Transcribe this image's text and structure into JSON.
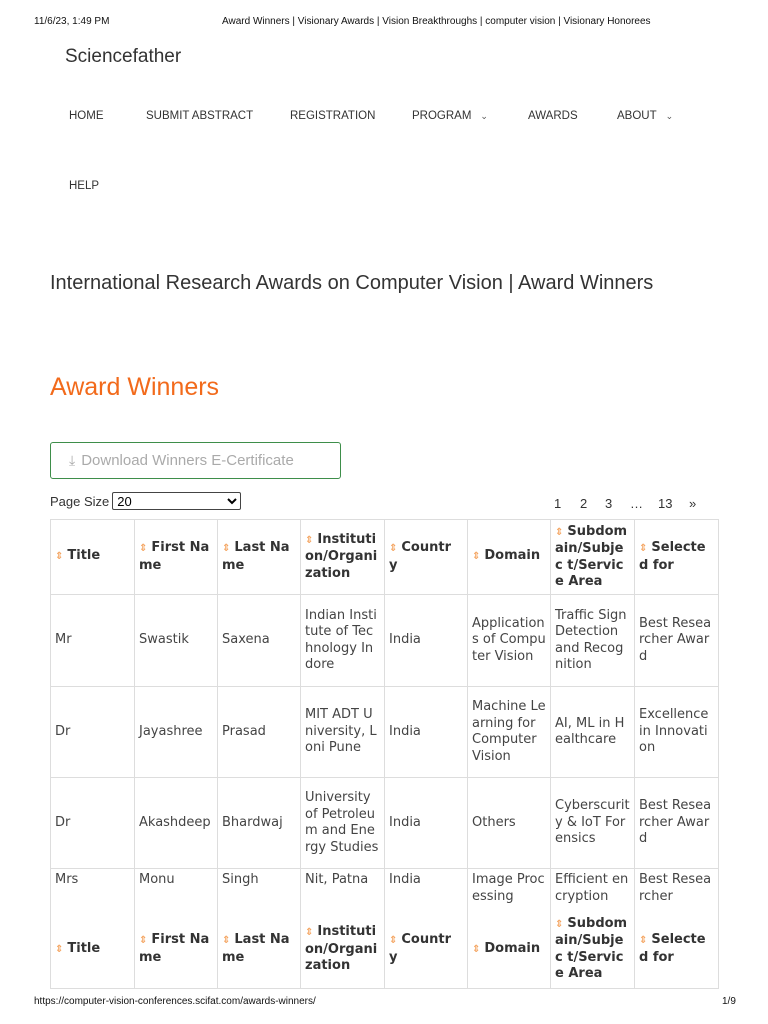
{
  "print_header": {
    "datetime": "11/6/23, 1:49 PM",
    "title": "Award Winners | Visionary Awards | Vision Breakthroughs | computer vision | Visionary Honorees"
  },
  "brand": "Sciencefather",
  "nav": [
    "HOME",
    "SUBMIT ABSTRACT",
    "REGISTRATION",
    "PROGRAM",
    "AWARDS",
    "ABOUT",
    "HELP"
  ],
  "heading": "International Research Awards on Computer Vision | Award Winners",
  "section_title": "Award Winners",
  "download_label": "Download Winners E-Certificate",
  "page_size": {
    "label": "Page Size",
    "value": "20"
  },
  "pagination": [
    "1",
    "2",
    "3",
    "…",
    "13",
    "»"
  ],
  "columns": [
    "Title",
    "First Name",
    "Last Name",
    "Instituti on/Organi zation",
    "Countr y",
    "Domain",
    "Subdom ain/Subjec t/Service Area",
    "Selected for"
  ],
  "rows": [
    [
      "Mr",
      "Swastik",
      "Saxena",
      "Indian Institute of Technology Indore",
      "India",
      "Applications of Computer Vision",
      "Traffic Sign Detection and Recognition",
      "Best Researcher Award"
    ],
    [
      "Dr",
      "Jayashree",
      "Prasad",
      "MIT ADT University, Loni Pune",
      "India",
      "Machine Learning for Computer Vision",
      "AI, ML in Healthcare",
      "Excellence in Innovation"
    ],
    [
      "Dr",
      "Akashdeep",
      "Bhardwaj",
      "University of Petroleum and Energy Studies",
      "India",
      "Others",
      "Cyberscurity & IoT Forensics",
      "Best Researcher Award"
    ],
    [
      "Mrs",
      "Monu",
      "Singh",
      "Nit, Patna",
      "India",
      "Image Processing",
      "Efficient encryption",
      "Best Researcher"
    ]
  ],
  "footer": {
    "url": "https://computer-vision-conferences.scifat.com/awards-winners/",
    "page": "1/9"
  },
  "colors": {
    "accent": "#f26a1b",
    "button_border": "#3e8e4a"
  }
}
